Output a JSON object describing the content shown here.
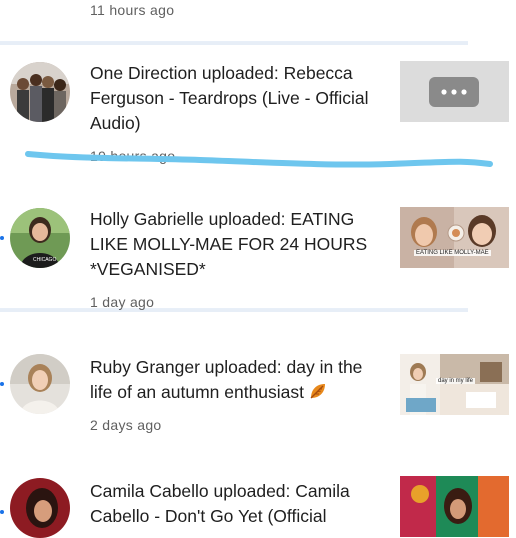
{
  "header_time": "11 hours ago",
  "notifications": [
    {
      "text": "One Direction uploaded: Rebecca Ferguson - Teardrops (Live - Official Audio)",
      "time": "19 hours ago",
      "avatar_icon": "group-photo",
      "thumbnail_icon": "more-dots-icon",
      "unread": false
    },
    {
      "text": "Holly Gabrielle uploaded: EATING LIKE MOLLY-MAE FOR 24 HOURS *VEGANISED*",
      "time": "1 day ago",
      "avatar_icon": "portrait",
      "thumbnail_label": "EATING LIKE MOLLY-MAE",
      "unread": true
    },
    {
      "text": "Ruby Granger uploaded: day in the life of an autumn enthusiast",
      "time": "2 days ago",
      "avatar_icon": "portrait",
      "thumbnail_label": "day in my life",
      "emoji": "autumn-leaf",
      "unread": true
    },
    {
      "text": "Camila Cabello uploaded: Camila Cabello - Don't Go Yet (Official",
      "time": "",
      "avatar_icon": "portrait",
      "unread": true
    }
  ],
  "colors": {
    "annotation_line": "#6ec6ee",
    "unread_dot": "#1a73e8",
    "meta_text": "#606060",
    "primary_text": "#1f1f1f"
  }
}
